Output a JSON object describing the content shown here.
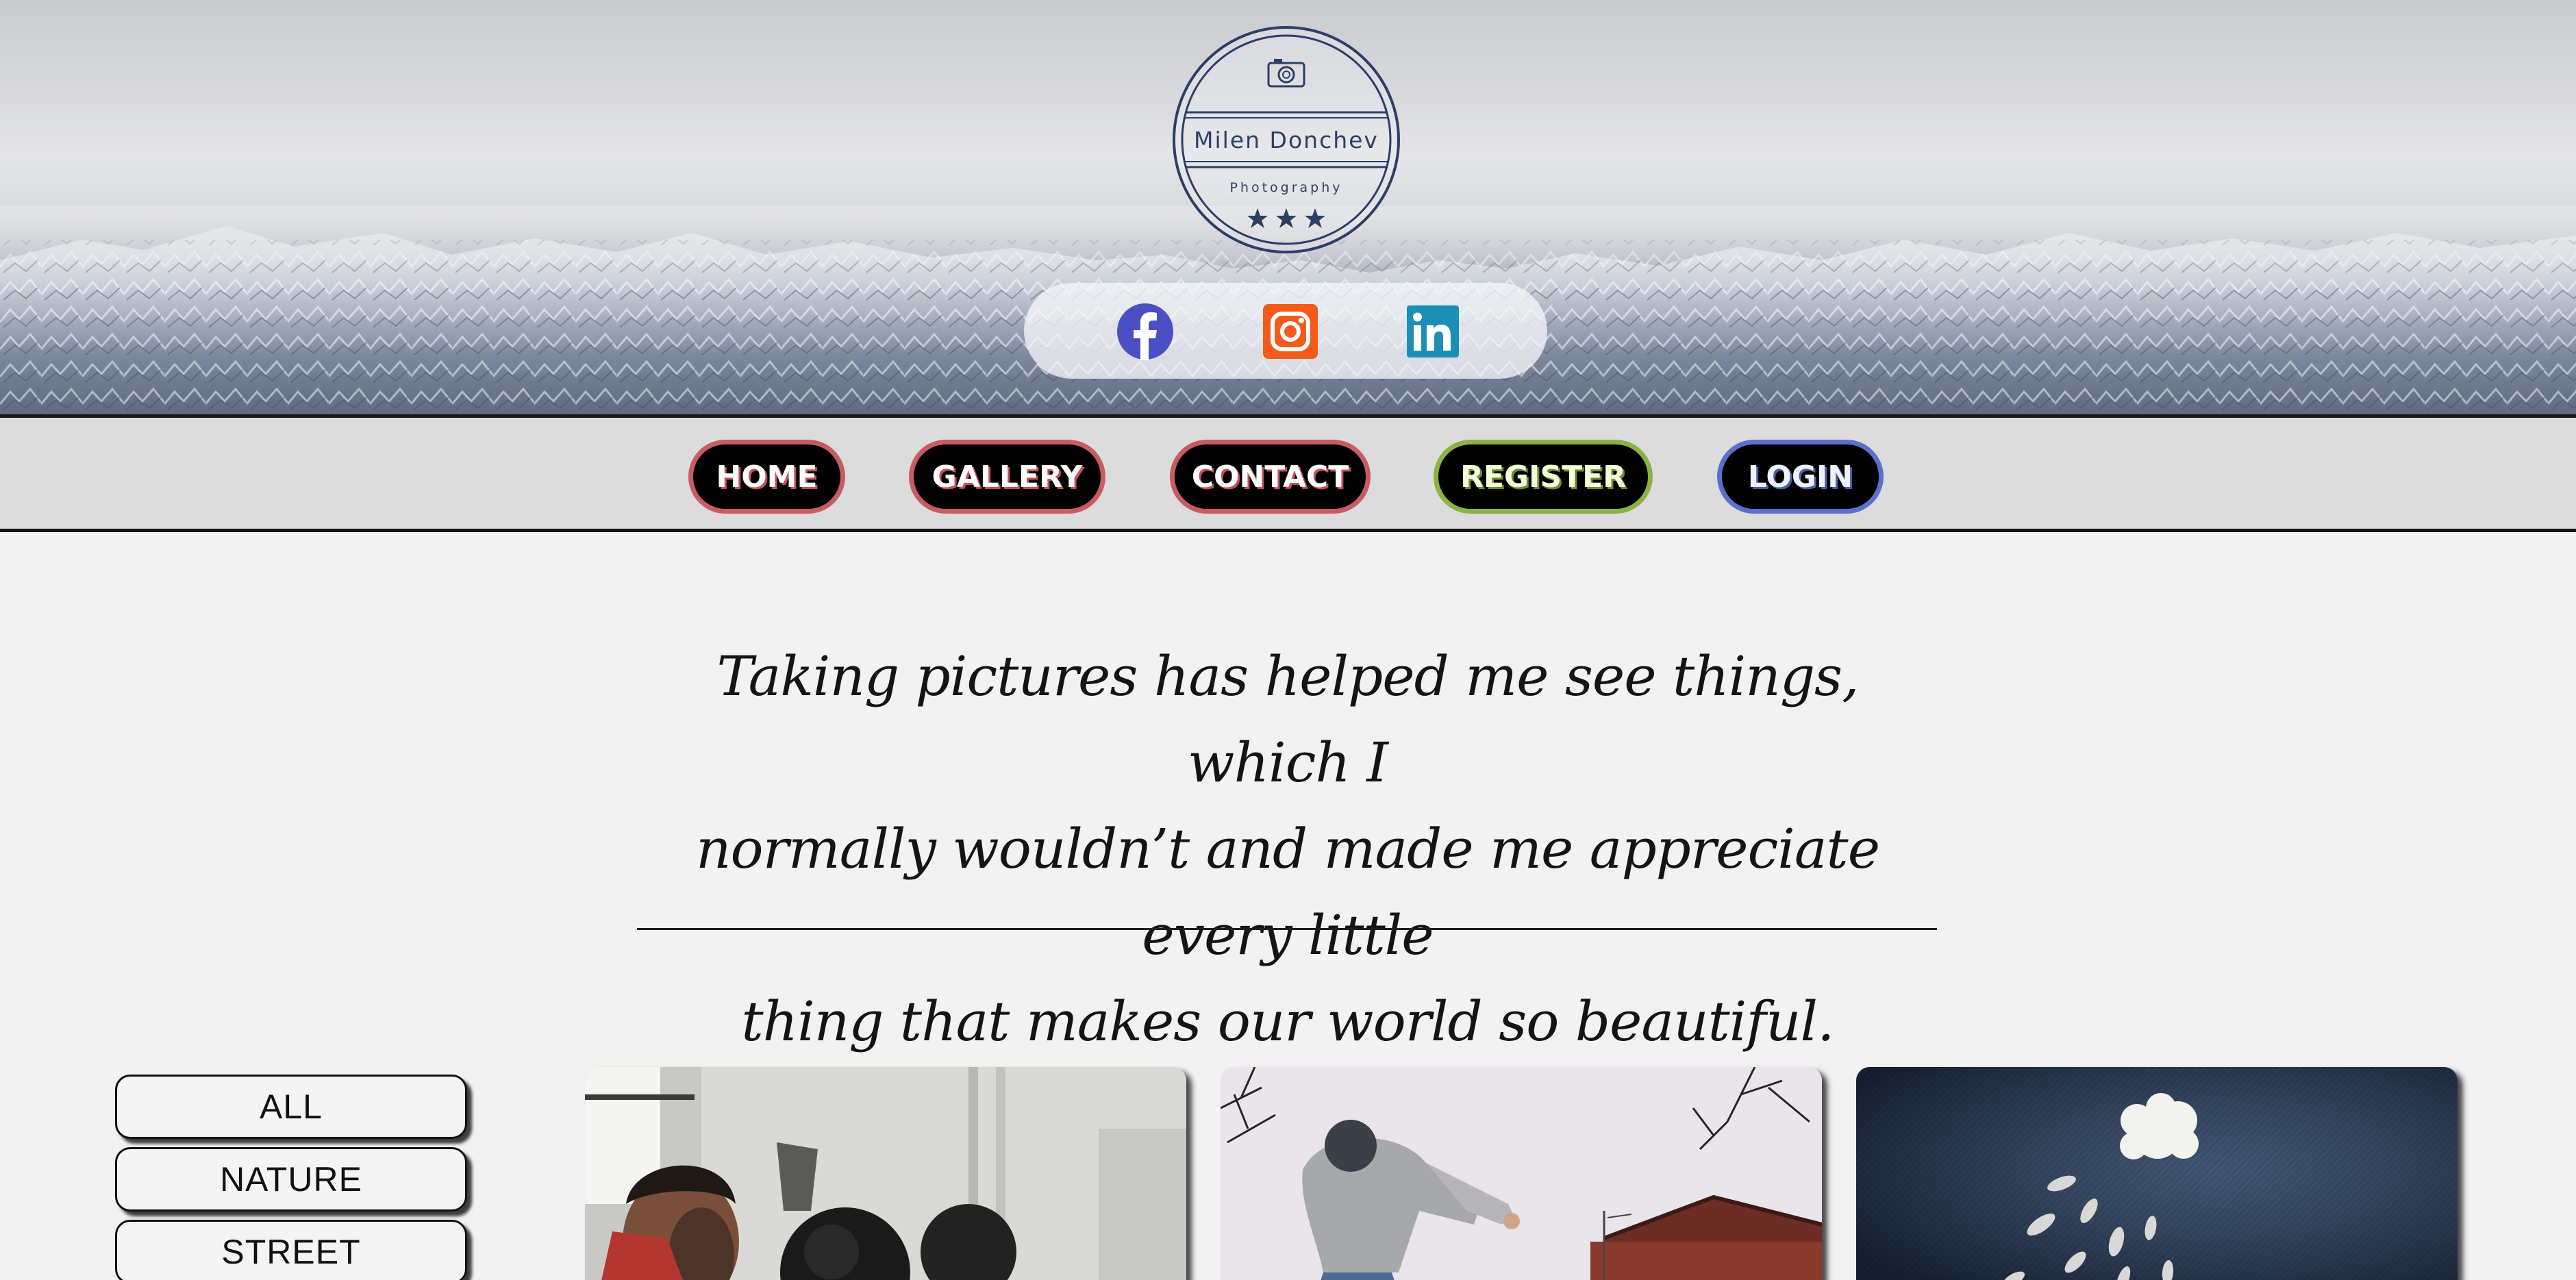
{
  "header": {
    "logo": {
      "name": "Milen Donchev",
      "subtitle": "Photography",
      "icon": "camera-icon"
    },
    "social": [
      {
        "name": "facebook",
        "icon": "facebook-icon",
        "color": "#4a4fc4"
      },
      {
        "name": "instagram",
        "icon": "instagram-icon",
        "color": "#f45b1a"
      },
      {
        "name": "linkedin",
        "icon": "linkedin-icon",
        "color": "#1e8fb4"
      }
    ]
  },
  "nav": {
    "home": "HOME",
    "gallery": "GALLERY",
    "contact": "CONTACT",
    "register": "REGISTER",
    "login": "LOGIN"
  },
  "colors": {
    "nav_red": "#c95b62",
    "nav_green": "#8ab341",
    "nav_blue": "#5b6fcc",
    "logo_navy": "#2d3f66"
  },
  "quote": {
    "line1": "Taking pictures has helped me see things, which I",
    "line2": "normally wouldn’t and made me appreciate every little",
    "line3": "thing that makes our world so beautiful."
  },
  "filters": {
    "all": "ALL",
    "nature": "NATURE",
    "street": "STREET"
  }
}
